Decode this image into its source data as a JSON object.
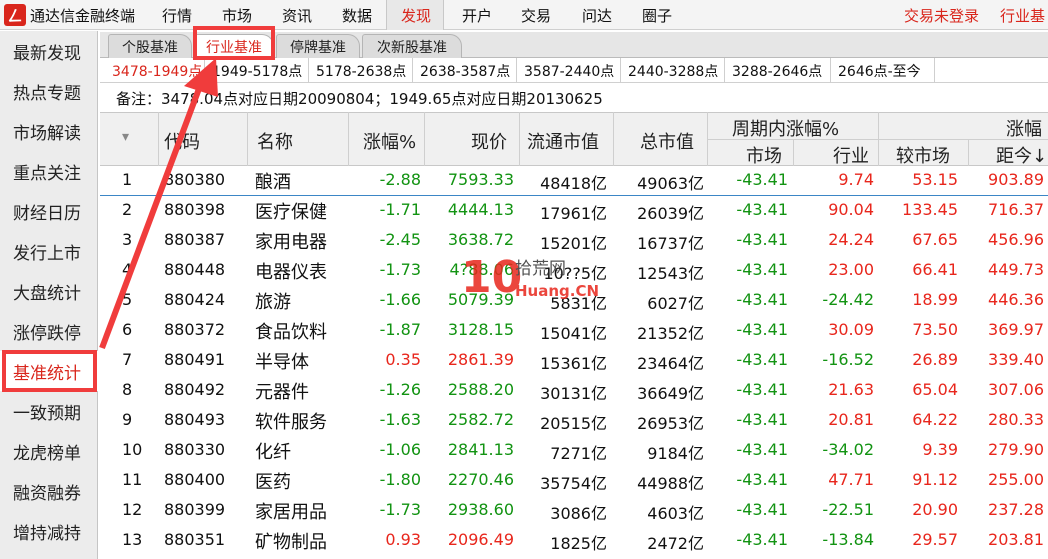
{
  "app": {
    "logo_glyph": "ㄥ",
    "title": "通达信金融终端",
    "menu": [
      "行情",
      "市场",
      "资讯",
      "数据",
      "发现",
      "开户",
      "交易",
      "问达",
      "圈子"
    ],
    "active_menu": "发现",
    "status_login": "交易未登录",
    "status_right": "行业基"
  },
  "sidebar": {
    "items": [
      "最新发现",
      "热点专题",
      "市场解读",
      "重点关注",
      "财经日历",
      "发行上市",
      "大盘统计",
      "涨停跌停",
      "基准统计",
      "一致预期",
      "龙虎榜单",
      "融资融券",
      "增持减持"
    ],
    "active": "基准统计"
  },
  "subtabs": {
    "items": [
      "个股基准",
      "行业基准",
      "停牌基准",
      "次新股基准"
    ],
    "active": "行业基准"
  },
  "ranges": [
    "3478-1949点",
    "1949-5178点",
    "5178-2638点",
    "2638-3587点",
    "3587-2440点",
    "2440-3288点",
    "3288-2646点",
    "2646点-至今"
  ],
  "note": "备注：3478.04点对应日期20090804；1949.65点对应日期20130625",
  "table": {
    "headers": {
      "index_arrow": "▾",
      "code": "代码",
      "name": "名称",
      "change": "涨幅%",
      "price": "现价",
      "float_cap": "流通市值",
      "total_cap": "总市值",
      "period_group": "周期内涨幅%",
      "market": "市场",
      "industry": "行业",
      "right_group": "涨幅",
      "vs_market": "较市场",
      "to_now": "距今↓"
    },
    "rows": [
      {
        "idx": "1",
        "code": "880380",
        "name": "酿酒",
        "change": "-2.88",
        "price": "7593.33",
        "float_cap": "48418亿",
        "total_cap": "49063亿",
        "market": "-43.41",
        "industry": "9.74",
        "vs_market": "53.15",
        "to_now": "903.89"
      },
      {
        "idx": "2",
        "code": "880398",
        "name": "医疗保健",
        "change": "-1.71",
        "price": "4444.13",
        "float_cap": "17961亿",
        "total_cap": "26039亿",
        "market": "-43.41",
        "industry": "90.04",
        "vs_market": "133.45",
        "to_now": "716.37"
      },
      {
        "idx": "3",
        "code": "880387",
        "name": "家用电器",
        "change": "-2.45",
        "price": "3638.72",
        "float_cap": "15201亿",
        "total_cap": "16737亿",
        "market": "-43.41",
        "industry": "24.24",
        "vs_market": "67.65",
        "to_now": "456.96"
      },
      {
        "idx": "4",
        "code": "880448",
        "name": "电器仪表",
        "change": "-1.73",
        "price": "4?88.06",
        "float_cap": "10??5亿",
        "total_cap": "12543亿",
        "market": "-43.41",
        "industry": "23.00",
        "vs_market": "66.41",
        "to_now": "449.73"
      },
      {
        "idx": "5",
        "code": "880424",
        "name": "旅游",
        "change": "-1.66",
        "price": "5079.39",
        "float_cap": "5831亿",
        "total_cap": "6027亿",
        "market": "-43.41",
        "industry": "-24.42",
        "vs_market": "18.99",
        "to_now": "446.36"
      },
      {
        "idx": "6",
        "code": "880372",
        "name": "食品饮料",
        "change": "-1.87",
        "price": "3128.15",
        "float_cap": "15041亿",
        "total_cap": "21352亿",
        "market": "-43.41",
        "industry": "30.09",
        "vs_market": "73.50",
        "to_now": "369.97"
      },
      {
        "idx": "7",
        "code": "880491",
        "name": "半导体",
        "change": "0.35",
        "price": "2861.39",
        "float_cap": "15361亿",
        "total_cap": "23464亿",
        "market": "-43.41",
        "industry": "-16.52",
        "vs_market": "26.89",
        "to_now": "339.40"
      },
      {
        "idx": "8",
        "code": "880492",
        "name": "元器件",
        "change": "-1.26",
        "price": "2588.20",
        "float_cap": "30131亿",
        "total_cap": "36649亿",
        "market": "-43.41",
        "industry": "21.63",
        "vs_market": "65.04",
        "to_now": "307.06"
      },
      {
        "idx": "9",
        "code": "880493",
        "name": "软件服务",
        "change": "-1.63",
        "price": "2582.72",
        "float_cap": "20515亿",
        "total_cap": "26953亿",
        "market": "-43.41",
        "industry": "20.81",
        "vs_market": "64.22",
        "to_now": "280.33"
      },
      {
        "idx": "10",
        "code": "880330",
        "name": "化纤",
        "change": "-1.06",
        "price": "2841.13",
        "float_cap": "7271亿",
        "total_cap": "9184亿",
        "market": "-43.41",
        "industry": "-34.02",
        "vs_market": "9.39",
        "to_now": "279.90"
      },
      {
        "idx": "11",
        "code": "880400",
        "name": "医药",
        "change": "-1.80",
        "price": "2270.46",
        "float_cap": "35754亿",
        "total_cap": "44988亿",
        "market": "-43.41",
        "industry": "47.71",
        "vs_market": "91.12",
        "to_now": "255.00"
      },
      {
        "idx": "12",
        "code": "880399",
        "name": "家居用品",
        "change": "-1.73",
        "price": "2938.60",
        "float_cap": "3086亿",
        "total_cap": "4603亿",
        "market": "-43.41",
        "industry": "-22.51",
        "vs_market": "20.90",
        "to_now": "237.28"
      },
      {
        "idx": "13",
        "code": "880351",
        "name": "矿物制品",
        "change": "0.93",
        "price": "2096.49",
        "float_cap": "1825亿",
        "total_cap": "2472亿",
        "market": "-43.41",
        "industry": "-13.84",
        "vs_market": "29.57",
        "to_now": "203.81"
      }
    ]
  },
  "watermark": {
    "big": "10",
    "cn": "拾荒网",
    "en": "Huang.CN"
  },
  "colors": {
    "up": "#e8261c",
    "down": "#129312",
    "accent": "#d9261c",
    "annotation": "#f03c3c"
  }
}
